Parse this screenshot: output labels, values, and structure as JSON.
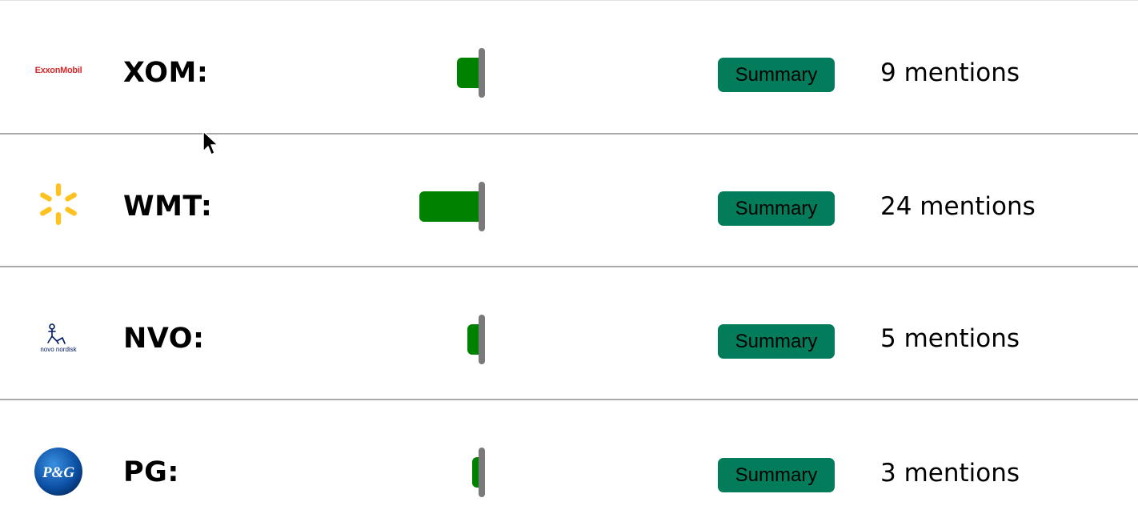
{
  "rows": [
    {
      "logo": "exxonmobil-logo",
      "logo_text": "ExxonMobil",
      "ticker": "XOM:",
      "mentions": 9,
      "mentions_label": "9 mentions",
      "summary_label": "Summary"
    },
    {
      "logo": "walmart-spark-logo",
      "ticker": "WMT:",
      "mentions": 24,
      "mentions_label": "24 mentions",
      "summary_label": "Summary"
    },
    {
      "logo": "novo-nordisk-logo",
      "logo_text": "novo nordisk",
      "ticker": "NVO:",
      "mentions": 5,
      "mentions_label": "5 mentions",
      "summary_label": "Summary"
    },
    {
      "logo": "pg-logo",
      "logo_text": "P&G",
      "ticker": "PG:",
      "mentions": 3,
      "mentions_label": "3 mentions",
      "summary_label": "Summary"
    }
  ],
  "colors": {
    "bar_fill": "#008200",
    "bar_axis": "#7a7a7a",
    "summary_button": "#037c5c",
    "exxon_red": "#d6282b",
    "walmart_yellow": "#ffc220",
    "novo_blue": "#001965",
    "pg_blue": "#0b4fa3"
  }
}
